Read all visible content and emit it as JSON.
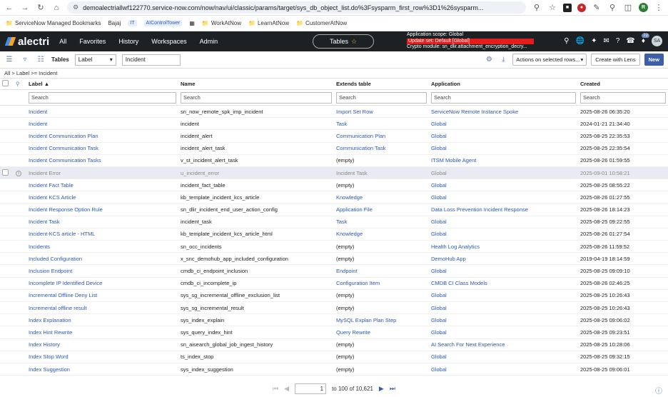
{
  "browser": {
    "url": "demoalectriallwf122770.service-now.com/now/nav/ui/classic/params/target/sys_db_object_list.do%3Fsysparm_first_row%3D1%26sysparm...",
    "bookmarks": [
      "ServiceNow Managed Bookmarks",
      "Bajaj",
      "IT",
      "AIControlTower",
      "WorkAtNow",
      "LearnAtNow",
      "CustomerAtNow"
    ],
    "profile_initial": "R"
  },
  "header": {
    "logo": "alectri",
    "menu": [
      "All",
      "Favorites",
      "History",
      "Workspaces",
      "Admin"
    ],
    "center_tab": "Tables",
    "scope_line1": "Application scope: Global",
    "scope_line2": "Update set: Default [Global]",
    "scope_line3": "Crypto module: sn_dlir.attachment_encryption_decry...",
    "badge": "72",
    "avatar": "SA"
  },
  "toolbar": {
    "title": "Tables",
    "field_select": "Label",
    "search_value": "Incident",
    "actions_select": "Actions on selected rows...",
    "create_lens": "Create with Lens",
    "new": "New"
  },
  "breadcrumb": "All > Label >= Incident",
  "columns": [
    "Label",
    "Name",
    "Extends table",
    "Application",
    "Created"
  ],
  "search_placeholder": "Search",
  "rows": [
    {
      "label": "Incident",
      "name": "sn_now_remote_spk_imp_incident",
      "extends": "Import Set Row",
      "app": "ServiceNow Remote Instance Spoke",
      "created": "2025-08-26 06:35:20"
    },
    {
      "label": "Incident",
      "name": "incident",
      "extends": "Task",
      "app": "Global",
      "created": "2024-01-21 21:34:40"
    },
    {
      "label": "Incident Communication Plan",
      "name": "incident_alert",
      "extends": "Communication Plan",
      "app": "Global",
      "created": "2025-08-25 22:35:53"
    },
    {
      "label": "Incident Communication Task",
      "name": "incident_alert_task",
      "extends": "Communication Task",
      "app": "Global",
      "created": "2025-08-25 22:35:54"
    },
    {
      "label": "Incident Communication Tasks",
      "name": "v_st_incident_alert_task",
      "extends": "(empty)",
      "app": "ITSM Mobile Agent",
      "created": "2025-08-26 01:59:55"
    },
    {
      "label": "Incident Error",
      "name": "u_incident_error",
      "extends": "Incident Task",
      "app": "Global",
      "created": "2025-09-01 10:58:21"
    },
    {
      "label": "Incident Fact Table",
      "name": "incident_fact_table",
      "extends": "(empty)",
      "app": "Global",
      "created": "2025-08-25 08:55:22"
    },
    {
      "label": "Incident KCS Article",
      "name": "kb_template_incident_kcs_article",
      "extends": "Knowledge",
      "app": "Global",
      "created": "2025-08-26 01:27:55"
    },
    {
      "label": "Incident Response Option Rule",
      "name": "sn_dlir_incident_end_user_action_config",
      "extends": "Application File",
      "app": "Data Loss Prevention Incident Response",
      "created": "2025-08-26 18:14:23"
    },
    {
      "label": "Incident Task",
      "name": "incident_task",
      "extends": "Task",
      "app": "Global",
      "created": "2025-08-25 09:22:55"
    },
    {
      "label": "Incident-KCS article - HTML",
      "name": "kb_template_incident_kcs_article_html",
      "extends": "Knowledge",
      "app": "Global",
      "created": "2025-08-26 01:27:54"
    },
    {
      "label": "Incidents",
      "name": "sn_occ_incidents",
      "extends": "(empty)",
      "app": "Health Log Analytics",
      "created": "2025-08-26 11:59:52"
    },
    {
      "label": "Included Configuration",
      "name": "x_snc_demohub_app_included_configuration",
      "extends": "(empty)",
      "app": "DemoHub App",
      "created": "2019-04-19 18:14:59"
    },
    {
      "label": "Inclusion Endpoint",
      "name": "cmdb_ci_endpoint_inclusion",
      "extends": "Endpoint",
      "app": "Global",
      "created": "2025-08-25 09:09:10"
    },
    {
      "label": "Incomplete IP Identified Device",
      "name": "cmdb_ci_incomplete_ip",
      "extends": "Configuration Item",
      "app": "CMDB CI Class Models",
      "created": "2025-08-26 02:46:25"
    },
    {
      "label": "Incremental Offline Deny List",
      "name": "sys_sg_incremental_offline_exclusion_list",
      "extends": "(empty)",
      "app": "Global",
      "created": "2025-08-25 10:26:43"
    },
    {
      "label": "Incremental offline result",
      "name": "sys_sg_incremental_result",
      "extends": "(empty)",
      "app": "Global",
      "created": "2025-08-25 10:26:43"
    },
    {
      "label": "Index Explanation",
      "name": "sys_index_explain",
      "extends": "MySQL Explan Plan Step",
      "app": "Global",
      "created": "2025-08-25 09:06:02"
    },
    {
      "label": "Index Hint Rewrite",
      "name": "sys_query_index_hint",
      "extends": "Query Rewrite",
      "app": "Global",
      "created": "2025-08-25 09:23:51"
    },
    {
      "label": "Index History",
      "name": "sn_aisearch_global_job_ingest_history",
      "extends": "(empty)",
      "app": "AI Search For Next Experience",
      "created": "2025-08-25 10:28:06"
    },
    {
      "label": "Index Stop Word",
      "name": "ts_index_stop",
      "extends": "(empty)",
      "app": "Global",
      "created": "2025-08-25 09:32:15"
    },
    {
      "label": "Index Suggestion",
      "name": "sys_index_suggestion",
      "extends": "(empty)",
      "app": "Global",
      "created": "2025-08-25 09:06:01"
    }
  ],
  "pagination": {
    "current": "1",
    "range": "to 100 of 10,621"
  }
}
